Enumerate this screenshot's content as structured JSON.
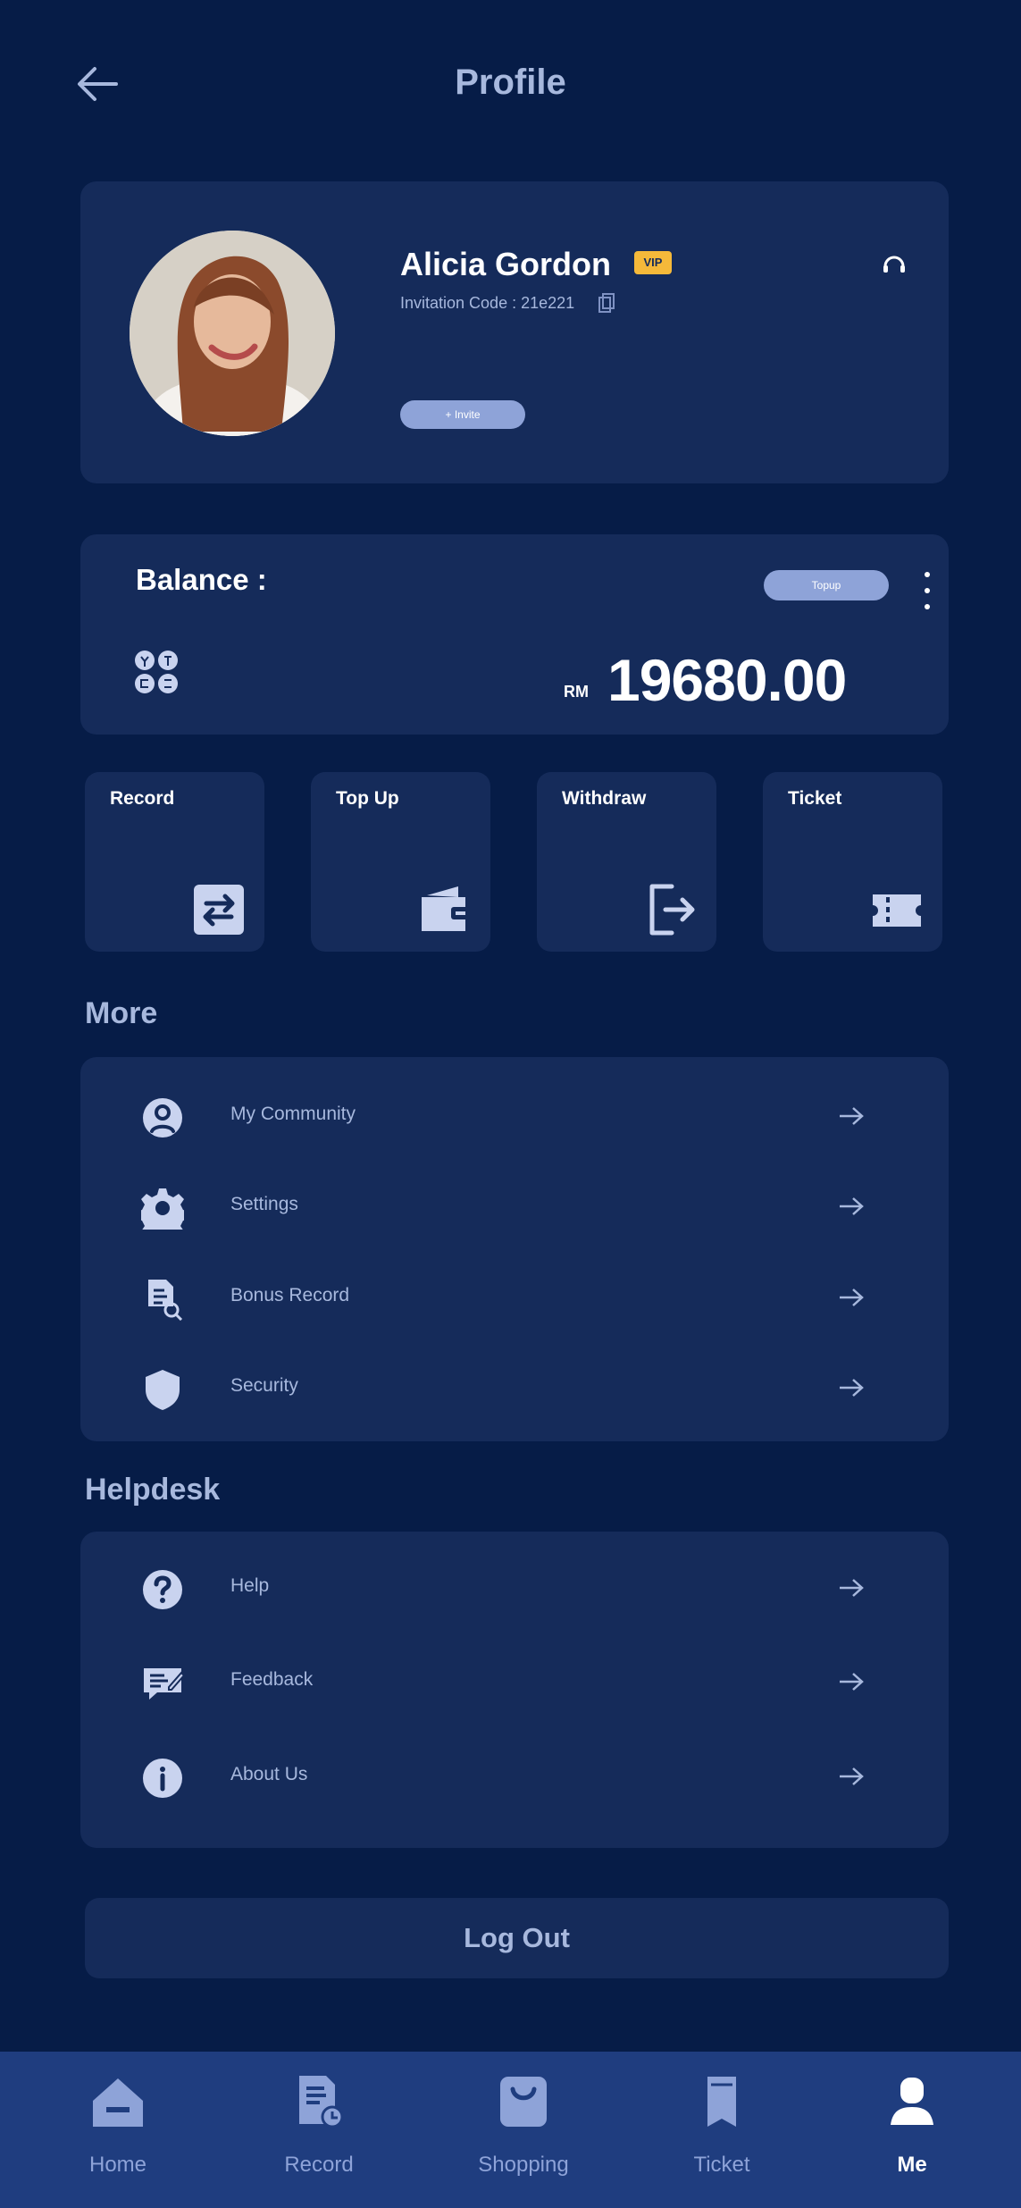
{
  "header": {
    "title": "Profile"
  },
  "profile": {
    "name": "Alicia Gordon",
    "vip_badge": "VIP",
    "invitation_code": "Invitation Code : 21e221",
    "invite_button": "+ Invite",
    "icons": {
      "support": "headset-icon",
      "copy": "copy-icon"
    }
  },
  "balance": {
    "label": "Balance :",
    "topup_button": "Topup",
    "currency": "RM",
    "amount": "19680.00",
    "icons": {
      "currency": "currency-exchange-icon",
      "more": "more-vertical-icon"
    }
  },
  "quick_actions": [
    {
      "label": "Record",
      "icon": "transfer-icon"
    },
    {
      "label": "Top Up",
      "icon": "wallet-icon"
    },
    {
      "label": "Withdraw",
      "icon": "logout-box-icon"
    },
    {
      "label": "Ticket",
      "icon": "ticket-icon"
    }
  ],
  "more": {
    "title": "More",
    "items": [
      {
        "label": "My Community",
        "icon": "user-circle-icon"
      },
      {
        "label": "Settings",
        "icon": "gear-icon"
      },
      {
        "label": "Bonus Record",
        "icon": "document-search-icon"
      },
      {
        "label": "Security",
        "icon": "shield-icon"
      }
    ]
  },
  "helpdesk": {
    "title": "Helpdesk",
    "items": [
      {
        "label": "Help",
        "icon": "help-circle-icon"
      },
      {
        "label": "Feedback",
        "icon": "feedback-icon"
      },
      {
        "label": "About Us",
        "icon": "info-icon"
      }
    ]
  },
  "logout_label": "Log Out",
  "bottom_nav": [
    {
      "label": "Home",
      "icon": "home-icon",
      "active": false
    },
    {
      "label": "Record",
      "icon": "record-icon",
      "active": false
    },
    {
      "label": "Shopping",
      "icon": "shopping-bag-icon",
      "active": false
    },
    {
      "label": "Ticket",
      "icon": "ticket-icon",
      "active": false
    },
    {
      "label": "Me",
      "icon": "person-icon",
      "active": true
    }
  ],
  "colors": {
    "background": "#061c47",
    "card": "#152b5a",
    "accent": "#8ea3d8",
    "vip": "#f5b93a",
    "nav": "#1f3d7f"
  }
}
